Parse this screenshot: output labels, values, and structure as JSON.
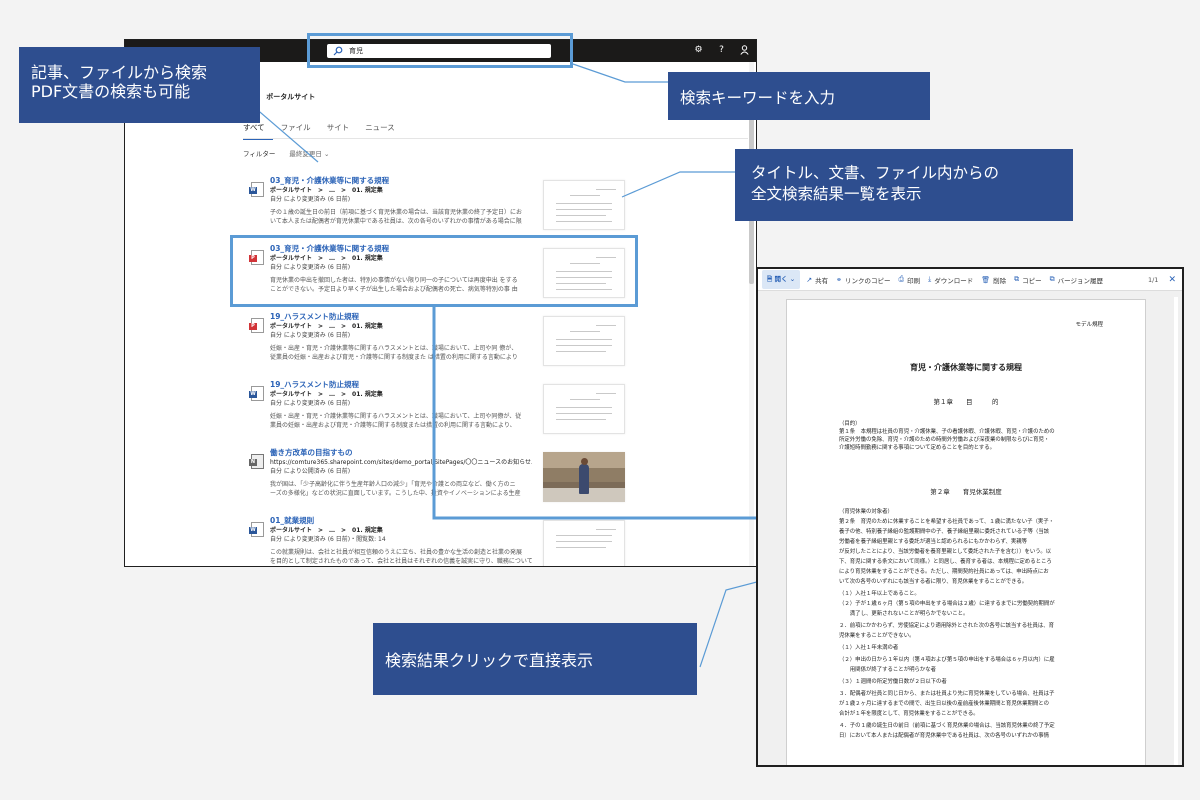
{
  "search": {
    "query": "育児"
  },
  "breadcrumb": {
    "site": "ポータルサイト"
  },
  "tabs": [
    {
      "label": "すべて",
      "active": true
    },
    {
      "label": "ファイル",
      "active": false
    },
    {
      "label": "サイト",
      "active": false
    },
    {
      "label": "ニュース",
      "active": false
    }
  ],
  "filter": {
    "label": "フィルター",
    "sort": "最終変更日"
  },
  "results": [
    {
      "icon": "word-file-icon",
      "title": "03_育児・介護休業等に関する規程",
      "site": "ポータルサイト　>　…　>　01. 規定集",
      "meta": "自分 により変更済み (6 日前)",
      "snippet1": "子の１歳の誕生日の前日（前項に基づく育児休業の場合は、当該育児休業の終了予定日）にお",
      "snippet2": "いて本人または配偶者が育児休業中である社員は、次の各号のいずれかの事情がある場合に限"
    },
    {
      "icon": "pdf-file-icon",
      "title": "03_育児・介護休業等に関する規程",
      "site": "ポータルサイト　>　…　>　01. 規定集",
      "meta": "自分 により変更済み (6 日前)",
      "snippet1": "育児休業の申出を撤回した者は、特別の事情がない限り同一の子については再度申出 をする",
      "snippet2": "ことができない。予定日より早く子が出生した場合および配偶者の死亡、病気等特別の事 由"
    },
    {
      "icon": "pdf-file-icon",
      "title": "19_ハラスメント防止規程",
      "site": "ポータルサイト　>　…　>　01. 規定集",
      "meta": "自分 により変更済み (6 日前)",
      "snippet1": "妊娠・出産・育児・介護休業等に関するハラスメントとは、職場において、上司や同 僚が、",
      "snippet2": "従業員の妊娠・出産および育児・介護等に関する制度また は措置の利用に関する言動により"
    },
    {
      "icon": "word-file-icon",
      "title": "19_ハラスメント防止規程",
      "site": "ポータルサイト　>　…　>　01. 規定集",
      "meta": "自分 により変更済み (6 日前)",
      "snippet1": "妊娠・出産・育児・介護休業等に関するハラスメントとは、職場において、上司や同僚が、従",
      "snippet2": "業員の妊娠・出産および育児・介護等に関する制度または措置の利用に関する言動により、"
    },
    {
      "icon": "news-icon",
      "title": "働き方改革の目指すもの",
      "site": "https://comture365.sharepoint.com/sites/demo_portal/SitePages/〇〇ニュースのお知らせ...",
      "meta": "自分 により公開済み (6 日前)",
      "snippet1": "我が国は、「少子高齢化に伴う生産年齢人口の減少」「育児や介護との両立など、働く方のニ",
      "snippet2": "ーズの多様化」などの状況に直面しています。こうした中、投資やイノベーションによる生産"
    },
    {
      "icon": "word-file-icon",
      "title": "01_就業規則",
      "site": "ポータルサイト　>　…　>　01. 規定集",
      "meta": "自分 により変更済み (6 日前)・閲覧数: 14",
      "snippet1": "この就業規則は、会社と社員が相互信頼のうえに立ち、社員の豊かな生活の創造と社業の発展",
      "snippet2": "を目的として制定されたものであって、会社と社員はそれぞれの信義を誠実に守り、職務について"
    }
  ],
  "callouts": {
    "articles_line1": "記事、ファイルから検索",
    "articles_line2": "PDF文書の検索も可能",
    "keyword": "検索キーワードを入力",
    "fulltext_line1": "タイトル、文書、ファイル内からの",
    "fulltext_line2": "全文検索結果一覧を表示",
    "click": "検索結果クリックで直接表示"
  },
  "viewer": {
    "toolbar": [
      "開く",
      "共有",
      "リンクのコピー",
      "印刷",
      "ダウンロード",
      "削除",
      "コピー",
      "バージョン履歴"
    ],
    "page_count": "1/1",
    "doc": {
      "header_right": "モデル規程",
      "title": "育児・介護休業等に関する規程",
      "chapter1": "第１章　　目　　　的",
      "c1_heading": "（目的）",
      "c1_lines": [
        "第１条　本規程は社員の育児・介護休業、子の看護休暇、介護休暇、育児・介護のための",
        "所定外労働の免除、育児・介護のための時間外労働および深夜業の制限ならびに育児・",
        "介護短時間勤務に関する事項について定めることを目的とする。"
      ],
      "chapter2": "第２章　　育児休業制度",
      "c2_heading": "（育児休業の対象者）",
      "c2_lines": [
        "第２条　育児のために休業することを希望する社員であって、１歳に満たない子（実子・",
        "養子の他、特別養子縁組の監護期間中の子、養子縁組里親に委託されている子等（当該",
        "労働者を養子縁組里親とする委託が適当と認められるにもかかわらず、実親等",
        "が反対したことにより、当該労働者を養育里親として委託された子を含む））をいう。以",
        "下、育児に関する条文において同様。）と同居し、養育する者は、本規程に定めるところ",
        "により育児休業をすることができる。ただし、期間契約社員にあっては、申出時点にお",
        "いて次の各号のいずれにも該当する者に限り、育児休業をすることができる。",
        "（１）入社１年以上であること。",
        "（２）子が１歳６ヶ月（第５項の申出をする場合は２歳）に達するまでに労働契約期間が",
        "　　満了し、更新されないことが明らかでないこと。",
        "２．前項にかかわらず、労使協定により適用除外とされた次の各号に該当する社員は、育",
        "児休業をすることができない。",
        "（１）入社１年未満の者",
        "（２）申出の日から１年以内（第４項および第５項の申出をする場合は６ヶ月以内）に雇",
        "　　用関係が終了することが明らかな者",
        "（３）１週間の所定労働日数が２日以下の者",
        "３．配偶者が社員と同じ日から、または社員より先に育児休業をしている場合、社員は子",
        "が１歳２ヶ月に達するまでの間で、出生日以後の産前産後休業期間と育児休業期間との",
        "合計が１年を限度として、育児休業をすることができる。",
        "４．子の１歳の誕生日の前日（前項に基づく育児休業の場合は、当該育児休業の終了予定",
        "日）において本人または配偶者が育児休業中である社員は、次の各号のいずれかの事情"
      ]
    }
  }
}
